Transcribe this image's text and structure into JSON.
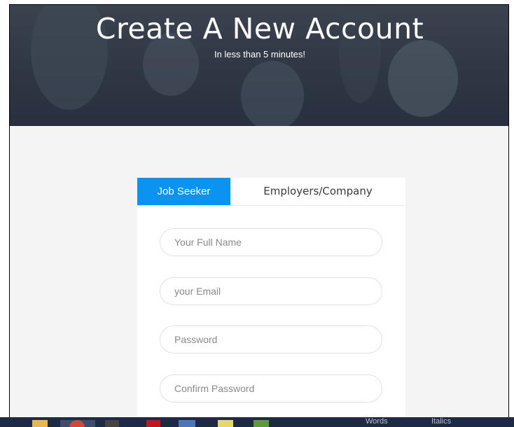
{
  "hero": {
    "title": "Create A New Account",
    "subtitle": "In less than 5 minutes!"
  },
  "tabs": [
    {
      "label": "Job Seeker",
      "active": true
    },
    {
      "label": "Employers/Company",
      "active": false
    }
  ],
  "form": {
    "full_name_placeholder": "Your Full Name",
    "email_placeholder": "your Email",
    "password_placeholder": "Password",
    "confirm_password_placeholder": "Confirm Password"
  },
  "taskbar": {
    "items": [
      "folder-icon",
      "chrome-icon",
      "app-icon",
      "pdf-icon",
      "app-icon",
      "notes-icon",
      "app-icon"
    ],
    "text_1": "Words",
    "text_2": "Italics"
  },
  "colors": {
    "accent": "#0a94f2",
    "hero_bg": "#2f3744",
    "page_bg": "#f4f4f5",
    "taskbar_bg": "#1c2a45"
  }
}
